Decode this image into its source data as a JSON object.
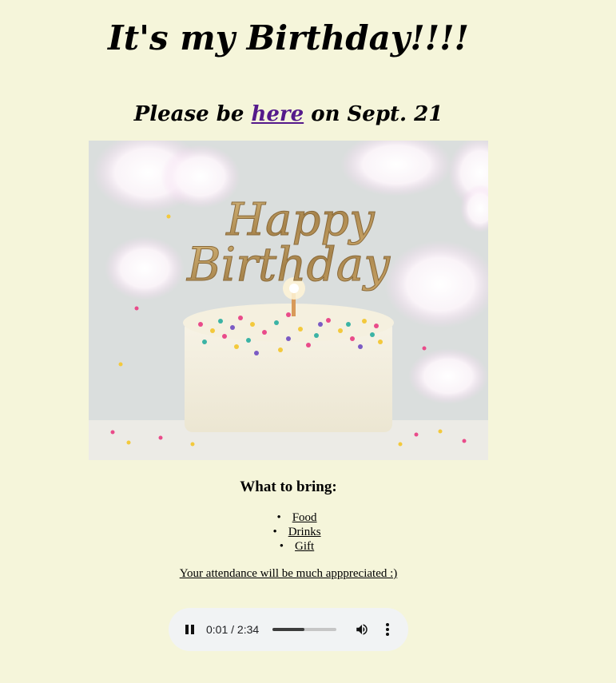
{
  "header": {
    "title": "It's my Birthday!!!!",
    "subtitle_before": "Please be ",
    "subtitle_link": "here",
    "subtitle_after": " on Sept. 21"
  },
  "hero_image": {
    "text_line1": "Happy",
    "text_line2": "Birthday"
  },
  "bring": {
    "heading": "What to bring:",
    "items": [
      "Food",
      "Drinks",
      "Gift"
    ]
  },
  "attendance_text": "Your attendance will be much apppreciated :)",
  "audio": {
    "current_time": "0:01",
    "separator": " / ",
    "duration": "2:34",
    "progress": 0.5,
    "pause_icon": "pause-icon",
    "volume_icon": "volume-icon",
    "menu_icon": "more-options-icon"
  },
  "colors": {
    "background": "#f5f5da",
    "link_visited": "#551a8b",
    "player_bg": "#f1f3f4"
  }
}
